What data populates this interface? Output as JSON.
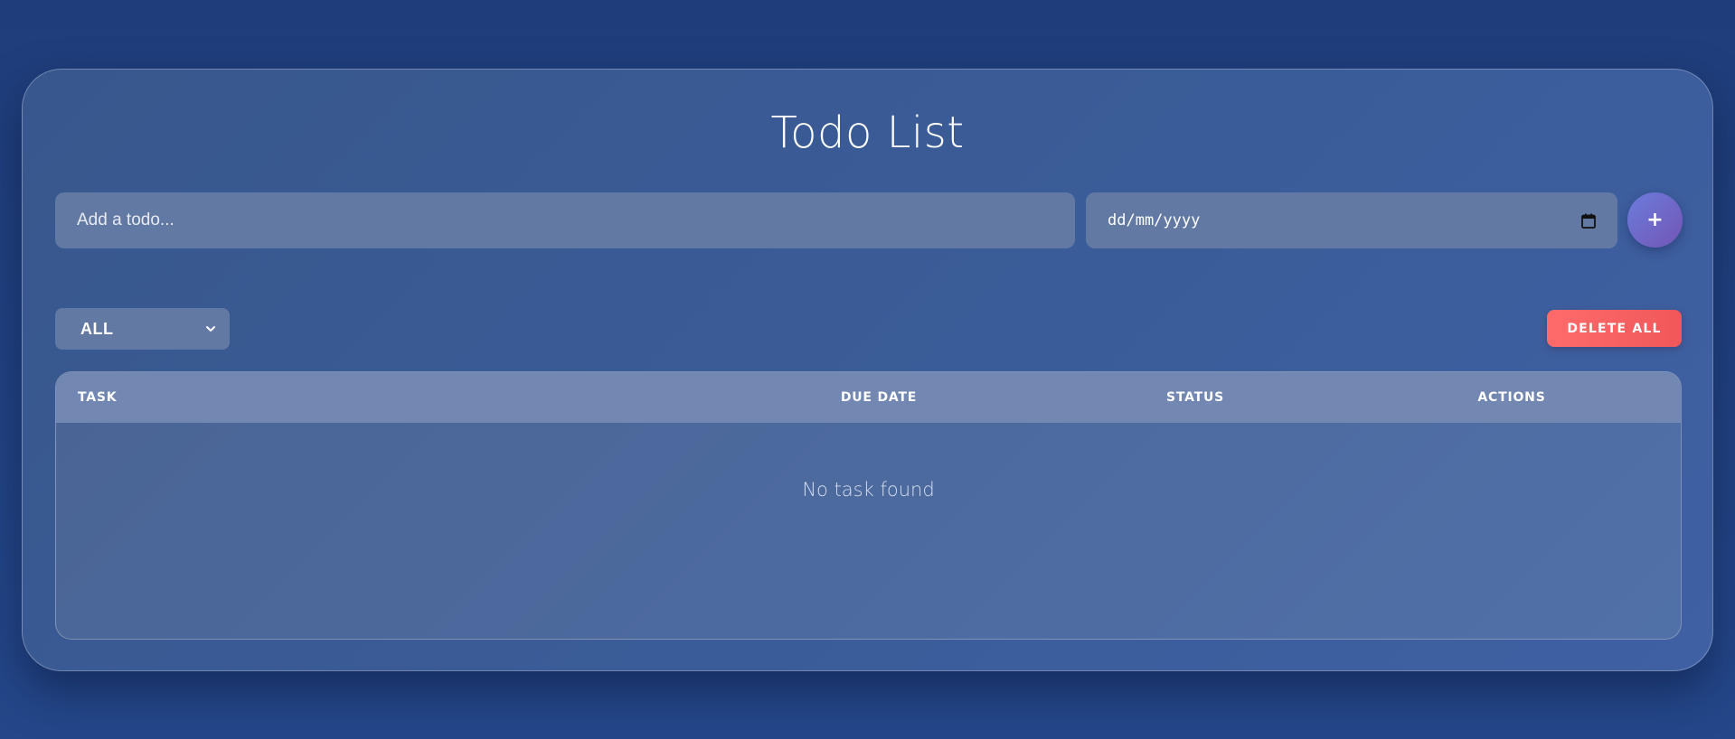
{
  "app": {
    "title": "Todo List"
  },
  "add_form": {
    "todo_placeholder": "Add a todo...",
    "date_placeholder": "dd/mm/yyyy",
    "date_icon": "calendar-icon",
    "add_button_icon": "+"
  },
  "toolbar": {
    "filter_selected": "ALL",
    "filter_icon": "chevron-down-icon",
    "delete_all_label": "DELETE ALL"
  },
  "table": {
    "columns": [
      "TASK",
      "DUE DATE",
      "STATUS",
      "ACTIONS"
    ],
    "rows": [],
    "empty_message": "No task found"
  },
  "colors": {
    "background": "#1f3d7a",
    "card": "#3a5c98",
    "input_fill": "#6279a3",
    "table_header": "#7287b1",
    "add_button": "#6a7cdc",
    "delete_button": "#ff6b6b"
  }
}
